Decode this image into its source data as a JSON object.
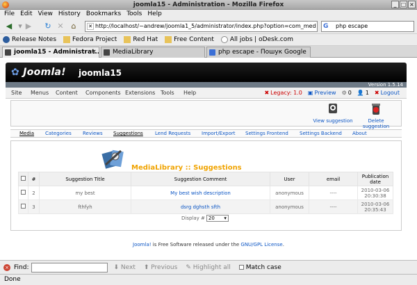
{
  "window": {
    "title": "joomla15 - Administration - Mozilla Firefox"
  },
  "menubar": [
    "File",
    "Edit",
    "View",
    "History",
    "Bookmarks",
    "Tools",
    "Help"
  ],
  "navbar": {
    "url": "http://localhost/~andrew/joomla1_5/administrator/index.php?option=com_med",
    "search": "php escape"
  },
  "bookmarks": [
    "Release Notes",
    "Fedora Project",
    "Red Hat",
    "Free Content",
    "All jobs | oDesk.com"
  ],
  "tabs": [
    {
      "label": "joomla15 - Administrat...",
      "active": true
    },
    {
      "label": "MediaLibrary",
      "active": false
    },
    {
      "label": "php escape - Пошук Google",
      "active": false
    }
  ],
  "joomla": {
    "logo": "Joomla!",
    "site": "joomla15",
    "version": "Version 1.5.14",
    "menu": [
      "Site",
      "Menus",
      "Content",
      "Components",
      "Extensions",
      "Tools",
      "Help"
    ],
    "status": {
      "legacy": "Legacy: 1.0",
      "preview": "Preview",
      "messages": "0",
      "users": "1",
      "logout": "Logout"
    },
    "toolbar": {
      "view": "View suggestion",
      "delete": "Delete suggestion"
    },
    "subtabs": [
      "Media",
      "Categories",
      "Reviews",
      "Suggestions",
      "Lend Requests",
      "Import/Export",
      "Settings Frontend",
      "Settings Backend",
      "About"
    ],
    "page_title": "MediaLibrary :: Suggestions",
    "table": {
      "headers": [
        "#",
        "Suggestion Title",
        "Suggestion Comment",
        "User",
        "email",
        "Publication date"
      ],
      "rows": [
        {
          "num": "2",
          "title": "my best",
          "comment": "My best wish description",
          "user": "anonymous",
          "email": "----",
          "date": "2010-03-06",
          "time": "20:30:38"
        },
        {
          "num": "3",
          "title": "fthfyh",
          "comment": "dsrg dghsth sfth",
          "user": "anonymous",
          "email": "----",
          "date": "2010-03-06",
          "time": "20:35:43"
        }
      ]
    },
    "pager": {
      "label": "Display #",
      "value": "20"
    },
    "footer": {
      "link1": "Joomla!",
      "text": " is Free Software released under the ",
      "link2": "GNU/GPL License",
      "end": "."
    }
  },
  "findbar": {
    "label": "Find:",
    "next": "Next",
    "previous": "Previous",
    "highlight": "Highlight all",
    "matchcase": "Match case"
  },
  "statusbar": {
    "text": "Done"
  }
}
